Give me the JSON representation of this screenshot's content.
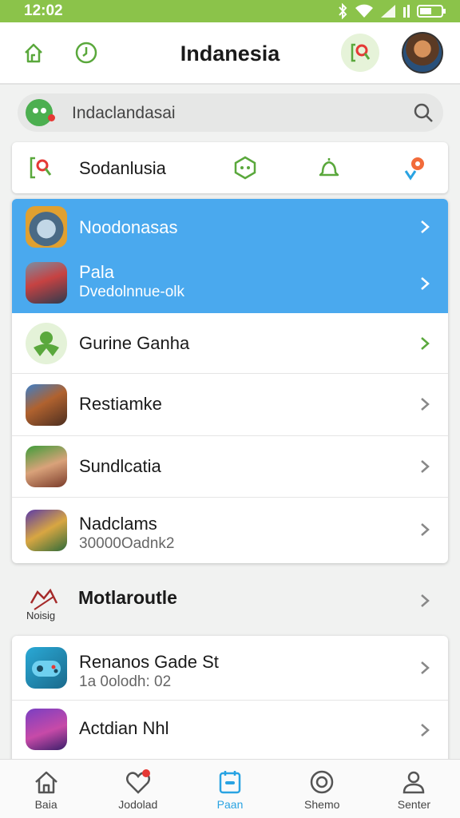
{
  "status_bar": {
    "time": "12:02"
  },
  "header": {
    "title": "Indanesia",
    "icons": [
      "home-icon",
      "clock-icon",
      "location-search-icon",
      "avatar"
    ]
  },
  "search": {
    "placeholder": "Indaclandasai",
    "icon": "search-icon"
  },
  "quick_bar": {
    "label": "Sodanlusia",
    "icons": [
      "scan-icon",
      "hexagon-icon",
      "bell-icon",
      "map-pin-icon"
    ]
  },
  "list": [
    {
      "title": "Noodonasas",
      "subtitle": "",
      "highlighted": true,
      "icon": "game-creature-icon"
    },
    {
      "title": "Pala",
      "subtitle": "Dvedolnnue-olk",
      "highlighted": true,
      "icon": "runner-icon"
    },
    {
      "title": "Gurine Ganha",
      "subtitle": "",
      "highlighted": false,
      "icon": "leaf-person-icon",
      "accent": true
    },
    {
      "title": "Restiamke",
      "subtitle": "",
      "highlighted": false,
      "icon": "warrior-icon"
    },
    {
      "title": "Sundlcatia",
      "subtitle": "",
      "highlighted": false,
      "icon": "girl-portrait-icon"
    },
    {
      "title": "Nadclams",
      "subtitle": "30000Oadnk2",
      "highlighted": false,
      "icon": "fantasy-game-icon"
    }
  ],
  "section": {
    "title": "Motlaroutle",
    "logo_text": "Noisig"
  },
  "list2": [
    {
      "title": "Renanos Gade St",
      "subtitle": "1a 0olodh: 02",
      "icon": "gamepad-icon"
    },
    {
      "title": "Actdian Nhl",
      "subtitle": "",
      "icon": "purple-game-icon"
    }
  ],
  "bottom_nav": [
    {
      "label": "Baia",
      "icon": "home-icon",
      "active": false
    },
    {
      "label": "Jodolad",
      "icon": "heart-icon",
      "active": false
    },
    {
      "label": "Paan",
      "icon": "calendar-icon",
      "active": true
    },
    {
      "label": "Shemo",
      "icon": "target-icon",
      "active": false
    },
    {
      "label": "Senter",
      "icon": "user-icon",
      "active": false
    }
  ],
  "colors": {
    "status_bar": "#8bc34a",
    "highlight": "#4aa9ee",
    "accent_green": "#5aa83c",
    "active_tab": "#29a3e2"
  }
}
